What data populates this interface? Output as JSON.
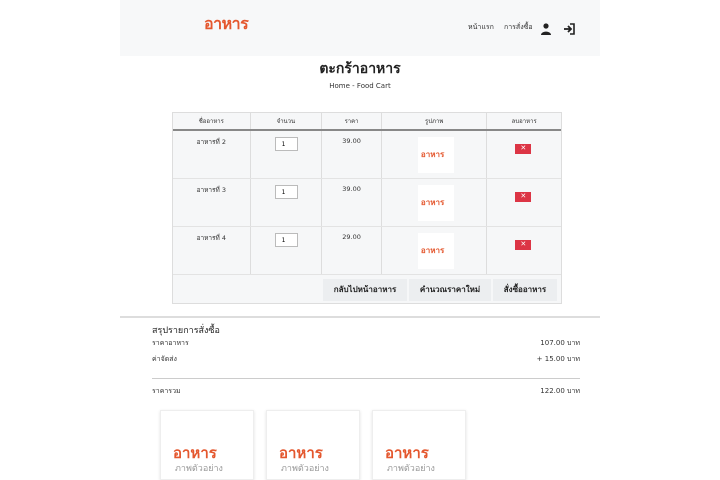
{
  "header": {
    "logo": "อาหาร",
    "nav": {
      "home": "หน้าแรก",
      "orders": "การสั่งซื้อ"
    },
    "icons": {
      "user": "user-icon",
      "login": "sign-in-icon"
    }
  },
  "page": {
    "title": "ตะกร้าอาหาร",
    "breadcrumb": "Home - Food Cart"
  },
  "table": {
    "headers": [
      "ชื่ออาหาร",
      "จำนวน",
      "ราคา",
      "รูปภาพ",
      "ลบอาหาร"
    ],
    "rows": [
      {
        "name": "อาหารที่ 2",
        "qty": "1",
        "price": "39.00",
        "thumb_text": "อาหาร"
      },
      {
        "name": "อาหารที่ 3",
        "qty": "1",
        "price": "39.00",
        "thumb_text": "อาหาร"
      },
      {
        "name": "อาหารที่ 4",
        "qty": "1",
        "price": "29.00",
        "thumb_text": "อาหาร"
      }
    ],
    "delete_label": "✕",
    "actions": {
      "back": "กลับไปหน้าอาหาร",
      "recalc": "คำนวณราคาใหม่",
      "order": "สั่งซื้ออาหาร"
    }
  },
  "summary": {
    "title": "สรุปรายการสั่งซื้อ",
    "food_label": "ราคาอาหาร",
    "food_value": "107.00 บาท",
    "shipping_label": "ค่าจัดส่ง",
    "shipping_value": "+ 15.00 บาท",
    "total_label": "ราคารวม",
    "total_value": "122.00 บาท"
  },
  "cards": [
    {
      "logo": "อาหาร",
      "sub": "ภาพตัวอย่าง"
    },
    {
      "logo": "อาหาร",
      "sub": "ภาพตัวอย่าง"
    },
    {
      "logo": "อาหาร",
      "sub": "ภาพตัวอย่าง"
    }
  ],
  "colors": {
    "brand": "#e4572e",
    "danger": "#dc3545",
    "button": "#eceef0"
  }
}
